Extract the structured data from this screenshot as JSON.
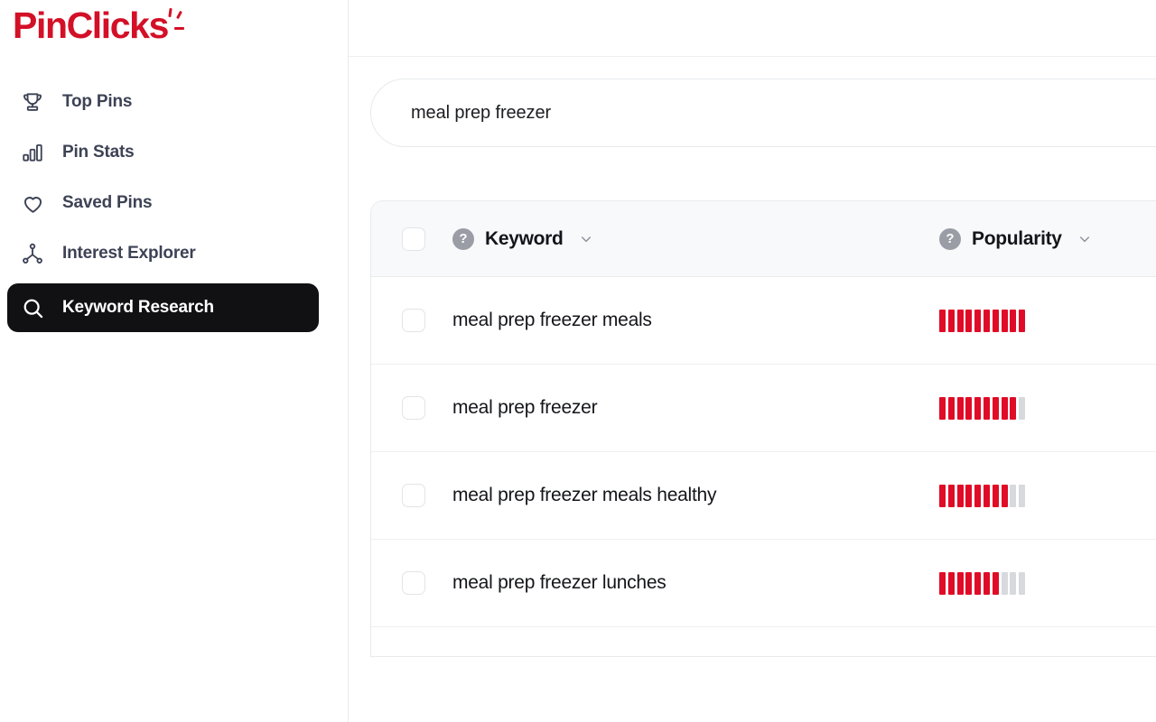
{
  "brand": {
    "name": "PinClicks",
    "color": "#d31027"
  },
  "sidebar": {
    "items": [
      {
        "label": "Top Pins",
        "icon": "trophy-icon",
        "active": false
      },
      {
        "label": "Pin Stats",
        "icon": "bar-chart-icon",
        "active": false
      },
      {
        "label": "Saved Pins",
        "icon": "heart-icon",
        "active": false
      },
      {
        "label": "Interest Explorer",
        "icon": "network-share-icon",
        "active": false
      },
      {
        "label": "Keyword Research",
        "icon": "search-icon",
        "active": true
      }
    ]
  },
  "search": {
    "value": "meal prep freezer",
    "placeholder": "Enter a keyword"
  },
  "table": {
    "columns": [
      {
        "key": "keyword",
        "label": "Keyword",
        "help": "?",
        "sort_icon": "chevron-down-icon"
      },
      {
        "key": "popularity",
        "label": "Popularity",
        "help": "?",
        "sort_icon": "chevron-down-icon"
      }
    ],
    "max_bars": 10,
    "rows": [
      {
        "keyword": "meal prep freezer meals",
        "popularity": 10
      },
      {
        "keyword": "meal prep freezer",
        "popularity": 9
      },
      {
        "keyword": "meal prep freezer meals healthy",
        "popularity": 8
      },
      {
        "keyword": "meal prep freezer lunches",
        "popularity": 7
      }
    ]
  },
  "colors": {
    "accent_red": "#e00b26",
    "bar_empty": "#d7d9dd",
    "active_nav_bg": "#111114",
    "header_bg": "#f8f9fb",
    "text": "#14151a"
  }
}
